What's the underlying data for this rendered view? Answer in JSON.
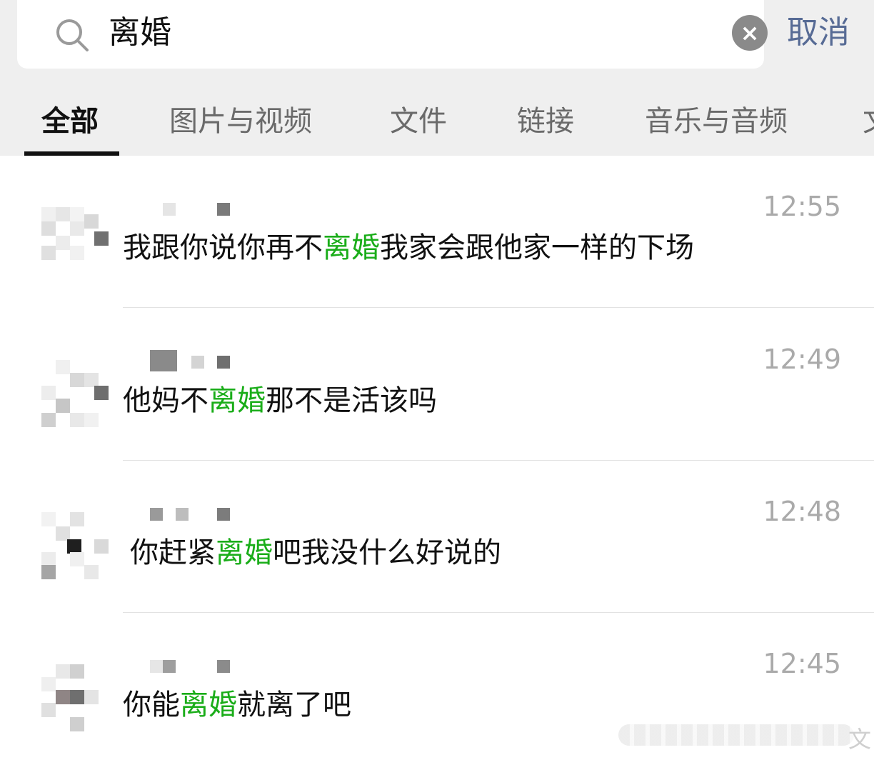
{
  "search": {
    "query": "离婚",
    "cancel_label": "取消"
  },
  "tabs": [
    {
      "label": "全部",
      "active": true
    },
    {
      "label": "图片与视频",
      "active": false
    },
    {
      "label": "文件",
      "active": false
    },
    {
      "label": "链接",
      "active": false
    },
    {
      "label": "音乐与音频",
      "active": false
    },
    {
      "label": "文",
      "active": false
    }
  ],
  "results": [
    {
      "time": "12:55",
      "message_before": "我跟你说你再不",
      "highlight": "离婚",
      "message_after": "我家会跟他家一样的下场"
    },
    {
      "time": "12:49",
      "message_before": "他妈不",
      "highlight": "离婚",
      "message_after": "那不是活该吗"
    },
    {
      "time": "12:48",
      "message_before": "你赶紧",
      "highlight": "离婚",
      "message_after": "吧我没什么好说的"
    },
    {
      "time": "12:45",
      "message_before": "你能",
      "highlight": "离婚",
      "message_after": "就离了吧"
    }
  ],
  "colors": {
    "highlight": "#1aad19",
    "cancel": "#576b95",
    "timestamp": "#aaaaaa"
  },
  "icons": {
    "search": "search-icon",
    "clear": "clear-icon"
  }
}
